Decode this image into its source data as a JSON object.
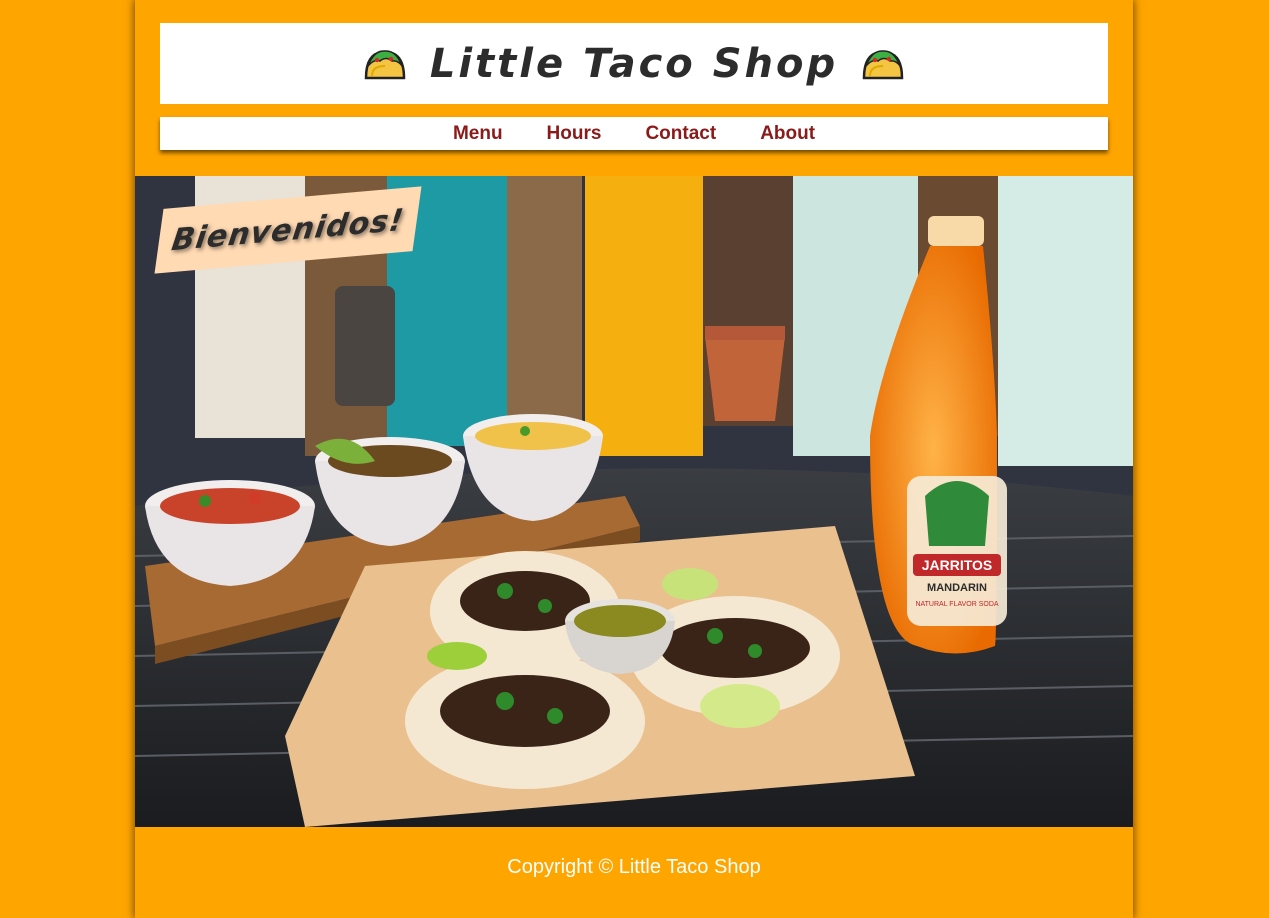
{
  "header": {
    "title": "Little Taco Shop",
    "left_icon": "taco-icon",
    "right_icon": "taco-icon"
  },
  "nav": {
    "items": [
      {
        "label": "Menu"
      },
      {
        "label": "Hours"
      },
      {
        "label": "Contact"
      },
      {
        "label": "About"
      }
    ]
  },
  "hero": {
    "welcome_text": "Bienvenidos!",
    "image": "tacos-with-salsas-and-jarritos-mandarin-soda",
    "bottle_label_brand": "JARRITOS",
    "bottle_label_flavor": "MANDARIN"
  },
  "footer": {
    "copyright": "Copyright © Little Taco Shop"
  },
  "colors": {
    "background": "#FFA500",
    "nav_link": "#8B1A1A",
    "banner": "#FFDAB3",
    "title_text": "#2c2c2c"
  }
}
